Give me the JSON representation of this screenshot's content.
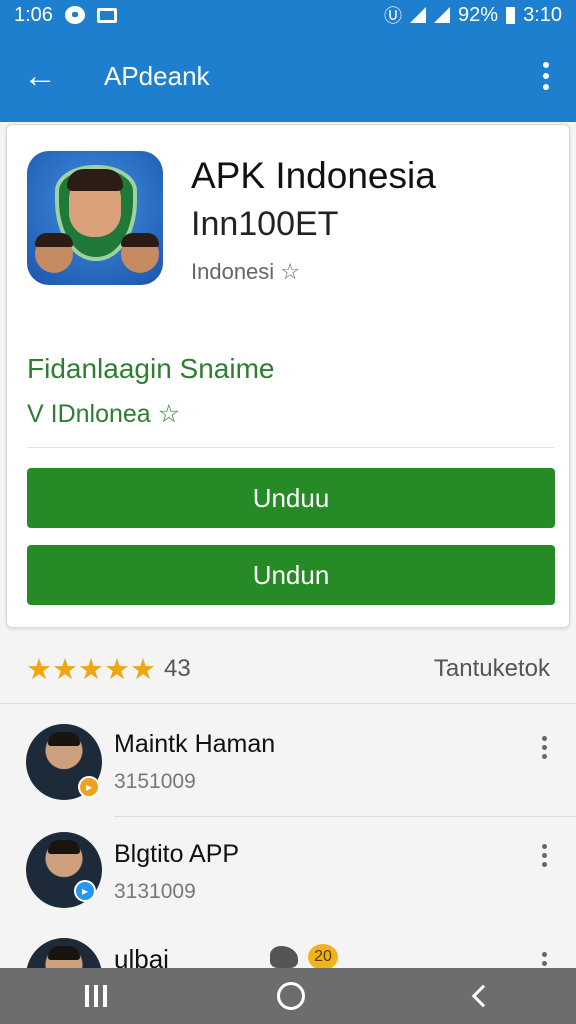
{
  "status_bar": {
    "time_left": "1:06",
    "battery": "92%",
    "time_right": "3:10"
  },
  "app_bar": {
    "back_icon": "arrow-left-icon",
    "title": "APdeank",
    "overflow_icon": "more-vert-icon"
  },
  "app": {
    "name": "APK Indonesia",
    "subtitle": "Inn100ET",
    "developer": "Indonesi ☆",
    "green_line_1": "Fidanlaagin Snaime",
    "green_line_2": "V IDnlonea ☆",
    "button_1": "Unduu",
    "button_2": "Undun",
    "accent_color": "#268a27"
  },
  "rating": {
    "stars": "★★★★★",
    "count": "43",
    "link": "Tantuketok"
  },
  "list": [
    {
      "title": "Maintk Haman",
      "subtitle": "3151009"
    },
    {
      "title": "Blgtito APP",
      "subtitle": "3131009"
    },
    {
      "title": "ulbai",
      "badge": "20"
    }
  ],
  "nav": {
    "recent_icon": "recent-apps-icon",
    "home_icon": "home-circle-icon",
    "back_icon": "back-chevron-icon"
  }
}
